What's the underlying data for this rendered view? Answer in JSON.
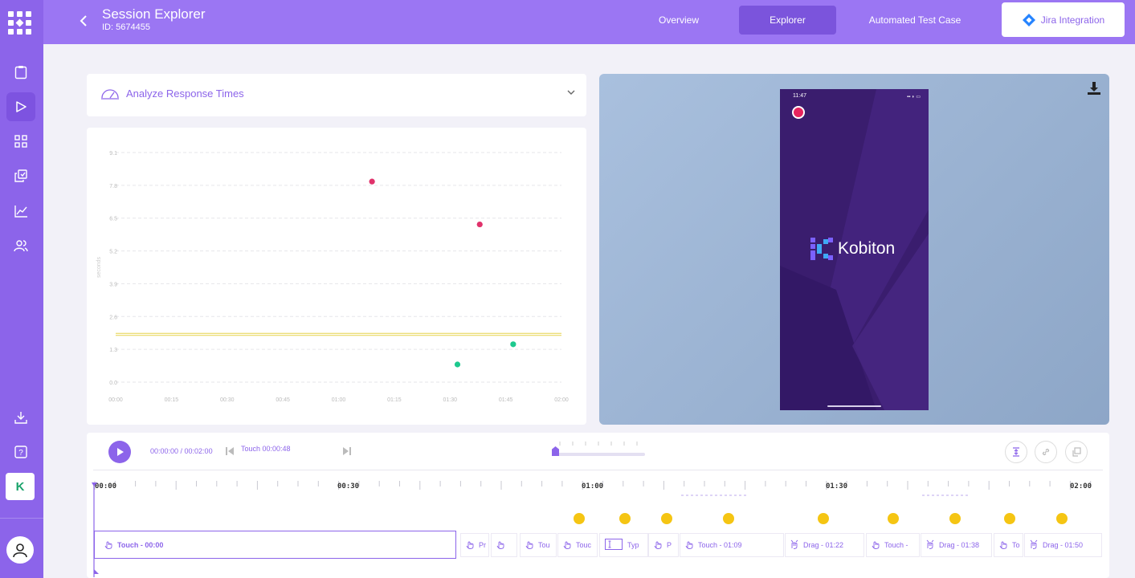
{
  "header": {
    "title": "Session Explorer",
    "session_id": "ID: 5674455",
    "tabs": [
      "Overview",
      "Explorer",
      "Automated Test Case"
    ],
    "active_tab": "Explorer",
    "jira_label": "Jira Integration"
  },
  "sidebar": {
    "items": [
      "clipboard-icon",
      "play-icon",
      "grid-icon",
      "copy-icon",
      "trend-icon",
      "users-icon"
    ],
    "bottom": [
      "download-icon",
      "help-icon"
    ],
    "k_label": "K"
  },
  "analyze": {
    "label": "Analyze Response Times"
  },
  "chart_data": {
    "type": "scatter",
    "ylabel": "seconds",
    "yticks": [
      "0.0",
      "1.3",
      "2.6",
      "3.9",
      "5.2",
      "6.5",
      "7.8",
      "9.1"
    ],
    "xticks": [
      "00:00",
      "00:15",
      "00:30",
      "00:45",
      "01:00",
      "01:15",
      "01:30",
      "01:45",
      "02:00"
    ],
    "ylim": [
      0,
      9.1
    ],
    "xlim_seconds": [
      0,
      120
    ],
    "threshold": 1.9,
    "series": [
      {
        "color": "#e0326b",
        "points": [
          [
            69,
            7.95
          ],
          [
            98,
            6.25
          ]
        ]
      },
      {
        "color": "#1dc98e",
        "points": [
          [
            92,
            0.7
          ],
          [
            107,
            1.5
          ]
        ]
      }
    ]
  },
  "device": {
    "time": "11:47",
    "brand": "Kobiton"
  },
  "player": {
    "time": "00:00:00 / 00:02:00",
    "current_event": "Touch 00:00:48"
  },
  "timeline": {
    "ruler": [
      "00:00",
      "00:30",
      "01:00",
      "01:30",
      "02:00"
    ],
    "events": [
      {
        "label": "Touch - 00:00",
        "icon": "hand"
      },
      {
        "label": "Pr",
        "icon": "hand"
      },
      {
        "label": "",
        "icon": "hand"
      },
      {
        "label": "Tou",
        "icon": "hand"
      },
      {
        "label": "Touc",
        "icon": "hand"
      },
      {
        "label": "Typ",
        "icon": "type"
      },
      {
        "label": "P",
        "icon": "hand"
      },
      {
        "label": "Touch - 01:09",
        "icon": "hand"
      },
      {
        "label": "Drag - 01:22",
        "icon": "drag"
      },
      {
        "label": "Touch -",
        "icon": "hand"
      },
      {
        "label": "Drag - 01:38",
        "icon": "drag"
      },
      {
        "label": "To",
        "icon": "hand"
      },
      {
        "label": "Drag - 01:50",
        "icon": "drag"
      }
    ]
  }
}
